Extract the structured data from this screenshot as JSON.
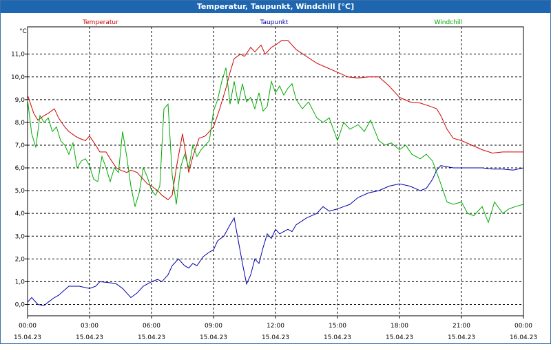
{
  "window": {
    "title": "Temperatur, Taupunkt, Windchill [°C]"
  },
  "chart_data": {
    "type": "line",
    "title": "Temperatur, Taupunkt, Windchill [°C]",
    "ylabel": "°C",
    "xlabel": "",
    "ylim": [
      -0.5,
      12.2
    ],
    "xlim": [
      0,
      24
    ],
    "grid": true,
    "legend_position": "top",
    "y_ticks": [
      0.0,
      1.0,
      2.0,
      3.0,
      4.0,
      5.0,
      6.0,
      7.0,
      8.0,
      9.0,
      10.0,
      11.0
    ],
    "y_tick_labels": [
      "0,0",
      "1,0",
      "2,0",
      "3,0",
      "4,0",
      "5,0",
      "6,0",
      "7,0",
      "8,0",
      "9,0",
      "10,0",
      "11,0"
    ],
    "x_ticks": [
      {
        "x": 0,
        "time": "00:00",
        "date": "15.04.23"
      },
      {
        "x": 3,
        "time": "03:00",
        "date": "15.04.23"
      },
      {
        "x": 6,
        "time": "06:00",
        "date": "15.04.23"
      },
      {
        "x": 9,
        "time": "09:00",
        "date": "15.04.23"
      },
      {
        "x": 12,
        "time": "12:00",
        "date": "15.04.23"
      },
      {
        "x": 15,
        "time": "15:00",
        "date": "15.04.23"
      },
      {
        "x": 18,
        "time": "18:00",
        "date": "15.04.23"
      },
      {
        "x": 21,
        "time": "21:00",
        "date": "15.04.23"
      },
      {
        "x": 24,
        "time": "00:00",
        "date": "16.04.23"
      }
    ],
    "series": [
      {
        "name": "Temperatur",
        "color": "#cc0000",
        "x": [
          0,
          0.3,
          0.5,
          0.8,
          1.0,
          1.3,
          1.5,
          1.8,
          2.0,
          2.3,
          2.5,
          2.8,
          3.0,
          3.3,
          3.5,
          3.8,
          4.0,
          4.3,
          4.5,
          4.8,
          5.0,
          5.3,
          5.5,
          5.8,
          6.0,
          6.3,
          6.5,
          6.8,
          7.0,
          7.2,
          7.5,
          7.8,
          8.0,
          8.3,
          8.6,
          9.0,
          9.3,
          9.6,
          9.8,
          10.0,
          10.3,
          10.5,
          10.8,
          11.0,
          11.3,
          11.5,
          11.8,
          12.0,
          12.3,
          12.6,
          13.0,
          13.5,
          14.0,
          14.5,
          15.0,
          15.5,
          16.0,
          16.5,
          17.0,
          17.5,
          18.0,
          18.5,
          19.0,
          19.5,
          19.8,
          20.0,
          20.3,
          20.6,
          21.0,
          21.5,
          22.0,
          22.5,
          23.0,
          23.5,
          24.0
        ],
        "values": [
          9.2,
          8.4,
          8.1,
          8.3,
          8.4,
          8.6,
          8.2,
          7.8,
          7.6,
          7.4,
          7.3,
          7.2,
          7.4,
          7.0,
          6.7,
          6.7,
          6.4,
          6.0,
          5.9,
          5.8,
          5.9,
          5.8,
          5.6,
          5.3,
          5.2,
          5.0,
          4.8,
          4.6,
          4.8,
          6.0,
          7.5,
          5.8,
          6.5,
          7.3,
          7.4,
          7.8,
          8.6,
          9.5,
          10.2,
          10.8,
          11.0,
          10.9,
          11.3,
          11.1,
          11.4,
          11.0,
          11.3,
          11.4,
          11.6,
          11.6,
          11.2,
          10.9,
          10.6,
          10.4,
          10.2,
          10.0,
          9.95,
          10.0,
          10.0,
          9.6,
          9.1,
          8.9,
          8.85,
          8.7,
          8.6,
          8.3,
          7.7,
          7.3,
          7.2,
          7.0,
          6.8,
          6.65,
          6.7,
          6.7,
          6.7
        ]
      },
      {
        "name": "Taupunkt",
        "color": "#0000aa",
        "x": [
          0,
          0.2,
          0.5,
          0.8,
          1.0,
          1.3,
          1.5,
          2.0,
          2.5,
          3.0,
          3.3,
          3.5,
          4.0,
          4.3,
          4.6,
          5.0,
          5.3,
          5.6,
          6.0,
          6.3,
          6.5,
          6.8,
          7.0,
          7.3,
          7.6,
          7.8,
          8.0,
          8.2,
          8.5,
          8.8,
          9.0,
          9.2,
          9.5,
          9.8,
          10.0,
          10.2,
          10.4,
          10.6,
          10.8,
          11.0,
          11.2,
          11.4,
          11.6,
          11.8,
          12.0,
          12.2,
          12.4,
          12.6,
          12.8,
          13.0,
          13.5,
          14.0,
          14.3,
          14.6,
          15.0,
          15.3,
          15.6,
          16.0,
          16.5,
          17.0,
          17.5,
          18.0,
          18.5,
          19.0,
          19.3,
          19.6,
          19.8,
          20.0,
          20.3,
          20.6,
          21.0,
          21.5,
          22.0,
          22.5,
          23.0,
          23.5,
          24.0
        ],
        "values": [
          0.1,
          0.3,
          0.0,
          -0.05,
          0.1,
          0.3,
          0.4,
          0.8,
          0.8,
          0.7,
          0.8,
          1.0,
          0.95,
          0.9,
          0.7,
          0.3,
          0.5,
          0.8,
          1.0,
          1.1,
          1.0,
          1.3,
          1.7,
          2.0,
          1.7,
          1.6,
          1.8,
          1.7,
          2.1,
          2.3,
          2.4,
          2.8,
          3.0,
          3.5,
          3.8,
          2.8,
          1.8,
          0.9,
          1.3,
          2.0,
          1.8,
          2.5,
          3.1,
          2.9,
          3.3,
          3.1,
          3.2,
          3.3,
          3.2,
          3.5,
          3.8,
          4.0,
          4.3,
          4.1,
          4.2,
          4.3,
          4.4,
          4.7,
          4.9,
          5.0,
          5.2,
          5.3,
          5.2,
          5.0,
          5.1,
          5.5,
          5.9,
          6.1,
          6.05,
          6.0,
          6.0,
          6.0,
          6.0,
          5.95,
          5.95,
          5.9,
          6.0
        ]
      },
      {
        "name": "Windchill",
        "color": "#00aa00",
        "x": [
          0,
          0.2,
          0.4,
          0.6,
          0.8,
          1.0,
          1.2,
          1.4,
          1.6,
          1.8,
          2.0,
          2.2,
          2.4,
          2.6,
          2.8,
          3.0,
          3.2,
          3.4,
          3.6,
          3.8,
          4.0,
          4.2,
          4.4,
          4.6,
          4.8,
          5.0,
          5.2,
          5.4,
          5.6,
          5.8,
          6.0,
          6.2,
          6.4,
          6.6,
          6.8,
          7.0,
          7.2,
          7.4,
          7.6,
          7.8,
          8.0,
          8.2,
          8.4,
          8.6,
          8.8,
          9.0,
          9.2,
          9.4,
          9.6,
          9.8,
          10.0,
          10.2,
          10.4,
          10.6,
          10.8,
          11.0,
          11.2,
          11.4,
          11.6,
          11.8,
          12.0,
          12.2,
          12.4,
          12.6,
          12.8,
          13.0,
          13.3,
          13.6,
          14.0,
          14.3,
          14.6,
          15.0,
          15.3,
          15.6,
          16.0,
          16.3,
          16.6,
          17.0,
          17.3,
          17.6,
          18.0,
          18.3,
          18.6,
          19.0,
          19.3,
          19.6,
          20.0,
          20.3,
          20.6,
          21.0,
          21.3,
          21.6,
          22.0,
          22.3,
          22.6,
          23.0,
          23.3,
          23.6,
          24.0
        ],
        "values": [
          9.0,
          7.5,
          6.9,
          8.3,
          8.0,
          8.2,
          7.6,
          7.8,
          7.2,
          7.0,
          6.6,
          7.1,
          6.0,
          6.3,
          6.4,
          6.1,
          5.5,
          5.4,
          6.5,
          6.0,
          5.4,
          6.0,
          5.8,
          7.6,
          6.5,
          5.2,
          4.3,
          4.9,
          6.0,
          5.6,
          5.0,
          4.8,
          5.2,
          8.6,
          8.8,
          5.7,
          4.4,
          6.0,
          6.6,
          6.0,
          7.0,
          6.5,
          6.8,
          7.0,
          7.2,
          8.5,
          9.0,
          9.8,
          10.4,
          8.8,
          9.8,
          8.8,
          9.7,
          8.9,
          9.1,
          8.6,
          9.3,
          8.5,
          8.7,
          9.8,
          9.3,
          9.6,
          9.2,
          9.5,
          9.7,
          9.0,
          8.6,
          8.9,
          8.2,
          8.0,
          8.2,
          7.2,
          8.0,
          7.7,
          7.9,
          7.6,
          8.1,
          7.2,
          7.0,
          7.1,
          6.8,
          7.0,
          6.6,
          6.4,
          6.6,
          6.3,
          5.3,
          4.5,
          4.4,
          4.5,
          4.0,
          3.9,
          4.3,
          3.6,
          4.5,
          4.0,
          4.2,
          4.3,
          4.4
        ]
      }
    ]
  }
}
